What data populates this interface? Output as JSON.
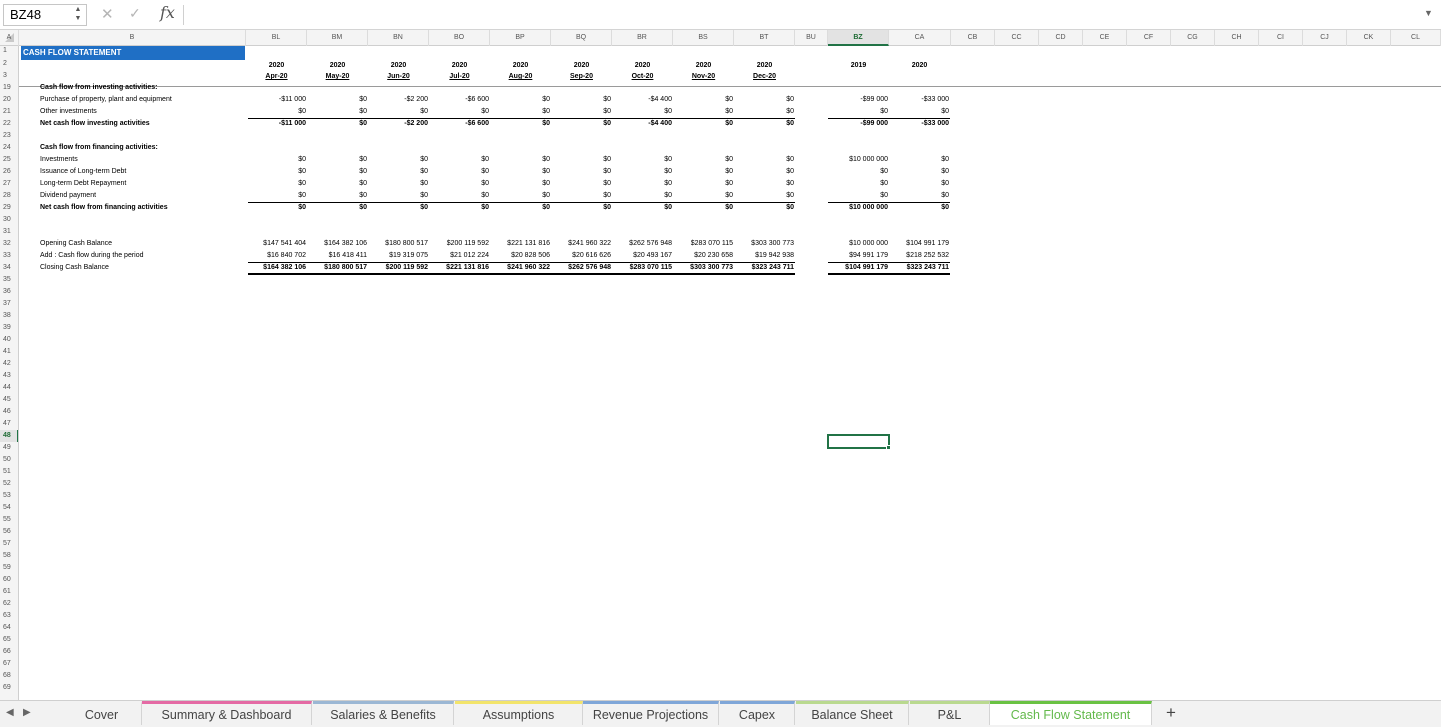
{
  "formula_bar": {
    "name_box": "BZ48",
    "cancel_icon": "✕",
    "enter_icon": "✓",
    "fx_label": "fx",
    "formula": ""
  },
  "columns": [
    "A",
    "B",
    "BL",
    "BM",
    "BN",
    "BO",
    "BP",
    "BQ",
    "BR",
    "BS",
    "BT",
    "BU",
    "BZ",
    "CA",
    "CB",
    "CC",
    "CD",
    "CE",
    "CF",
    "CG",
    "CH",
    "CI",
    "CJ",
    "CK",
    "CL"
  ],
  "selected_column": "BZ",
  "rows": [
    "1",
    "2",
    "3",
    "19",
    "20",
    "21",
    "22",
    "23",
    "24",
    "25",
    "26",
    "27",
    "28",
    "29",
    "30",
    "31",
    "32",
    "33",
    "34",
    "35",
    "36",
    "37",
    "38",
    "39",
    "40",
    "41",
    "42",
    "43",
    "44",
    "45",
    "46",
    "47",
    "48",
    "49",
    "50",
    "51",
    "52",
    "53",
    "54",
    "55",
    "56",
    "57",
    "58",
    "59",
    "60",
    "61",
    "62",
    "63",
    "64",
    "65",
    "66",
    "67",
    "68",
    "69"
  ],
  "selected_row": "48",
  "sheet": {
    "title": "CASH FLOW STATEMENT",
    "monthly_years": [
      "2020",
      "2020",
      "2020",
      "2020",
      "2020",
      "2020",
      "2020",
      "2020",
      "2020"
    ],
    "monthly_months": [
      "Apr-20",
      "May-20",
      "Jun-20",
      "Jul-20",
      "Aug-20",
      "Sep-20",
      "Oct-20",
      "Nov-20",
      "Dec-20"
    ],
    "annual_years": [
      "2019",
      "2020"
    ],
    "investing": {
      "header": "Cash flow from investing activities:",
      "rows": [
        {
          "label": "Purchase of property, plant and equipment",
          "m": [
            "-$11 000",
            "$0",
            "-$2 200",
            "-$6 600",
            "$0",
            "$0",
            "-$4 400",
            "$0",
            "$0"
          ],
          "a": [
            "-$99 000",
            "-$33 000"
          ]
        },
        {
          "label": "Other investments",
          "m": [
            "$0",
            "$0",
            "$0",
            "$0",
            "$0",
            "$0",
            "$0",
            "$0",
            "$0"
          ],
          "a": [
            "$0",
            "$0"
          ]
        }
      ],
      "total": {
        "label": "Net cash flow investing activities",
        "m": [
          "-$11 000",
          "$0",
          "-$2 200",
          "-$6 600",
          "$0",
          "$0",
          "-$4 400",
          "$0",
          "$0"
        ],
        "a": [
          "-$99 000",
          "-$33 000"
        ]
      }
    },
    "financing": {
      "header": "Cash flow from financing activities:",
      "rows": [
        {
          "label": "Investments",
          "m": [
            "$0",
            "$0",
            "$0",
            "$0",
            "$0",
            "$0",
            "$0",
            "$0",
            "$0"
          ],
          "a": [
            "$10 000 000",
            "$0"
          ]
        },
        {
          "label": "Issuance of Long-term Debt",
          "m": [
            "$0",
            "$0",
            "$0",
            "$0",
            "$0",
            "$0",
            "$0",
            "$0",
            "$0"
          ],
          "a": [
            "$0",
            "$0"
          ]
        },
        {
          "label": "Long-term Debt Repayment",
          "m": [
            "$0",
            "$0",
            "$0",
            "$0",
            "$0",
            "$0",
            "$0",
            "$0",
            "$0"
          ],
          "a": [
            "$0",
            "$0"
          ]
        },
        {
          "label": "Dividend payment",
          "m": [
            "$0",
            "$0",
            "$0",
            "$0",
            "$0",
            "$0",
            "$0",
            "$0",
            "$0"
          ],
          "a": [
            "$0",
            "$0"
          ]
        }
      ],
      "total": {
        "label": "Net cash flow from financing activities",
        "m": [
          "$0",
          "$0",
          "$0",
          "$0",
          "$0",
          "$0",
          "$0",
          "$0",
          "$0"
        ],
        "a": [
          "$10 000 000",
          "$0"
        ]
      }
    },
    "cash": {
      "rows": [
        {
          "label": "Opening Cash Balance",
          "m": [
            "$147 541 404",
            "$164 382 106",
            "$180 800 517",
            "$200 119 592",
            "$221 131 816",
            "$241 960 322",
            "$262 576 948",
            "$283 070 115",
            "$303 300 773"
          ],
          "a": [
            "$10 000 000",
            "$104 991 179"
          ]
        },
        {
          "label": "Add : Cash flow during the period",
          "m": [
            "$16 840 702",
            "$16 418 411",
            "$19 319 075",
            "$21 012 224",
            "$20 828 506",
            "$20 616 626",
            "$20 493 167",
            "$20 230 658",
            "$19 942 938"
          ],
          "a": [
            "$94 991 179",
            "$218 252 532"
          ]
        }
      ],
      "total": {
        "label": "Closing Cash Balance",
        "m": [
          "$164 382 106",
          "$180 800 517",
          "$200 119 592",
          "$221 131 816",
          "$241 960 322",
          "$262 576 948",
          "$283 070 115",
          "$303 300 773",
          "$323 243 711"
        ],
        "a": [
          "$104 991 179",
          "$323 243 711"
        ]
      }
    }
  },
  "tabs": [
    {
      "label": "Cover",
      "color": ""
    },
    {
      "label": "Summary & Dashboard",
      "color": "#e46aa4"
    },
    {
      "label": "Salaries & Benefits",
      "color": "#9bb7d4"
    },
    {
      "label": "Assumptions",
      "color": "#f2e46b"
    },
    {
      "label": "Revenue Projections",
      "color": "#7fa6d8"
    },
    {
      "label": "Capex",
      "color": "#7fa6d8"
    },
    {
      "label": "Balance Sheet",
      "color": "#b9d98f"
    },
    {
      "label": "P&L",
      "color": "#b9d98f"
    },
    {
      "label": "Cash Flow Statement",
      "color": "#6ac243"
    }
  ],
  "active_tab": "Cash Flow Statement",
  "add_sheet_label": "+",
  "colors": {
    "title_fill": "#1f6fc5",
    "selection": "#217346",
    "active_tab_text": "#63b94b"
  }
}
